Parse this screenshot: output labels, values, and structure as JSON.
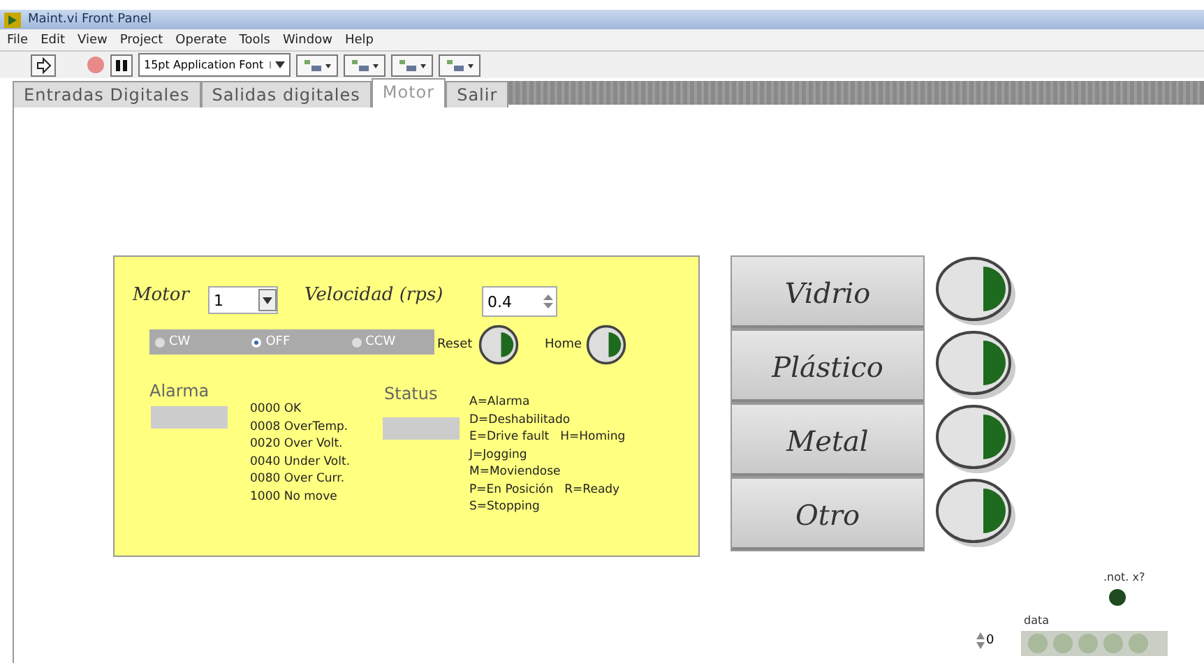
{
  "window": {
    "title": "Maint.vi Front Panel"
  },
  "menu": [
    "File",
    "Edit",
    "View",
    "Project",
    "Operate",
    "Tools",
    "Window",
    "Help"
  ],
  "toolbar": {
    "font": "15pt Application Font"
  },
  "tabs": [
    {
      "label": "Entradas Digitales",
      "selected": false
    },
    {
      "label": "Salidas digitales",
      "selected": false
    },
    {
      "label": "Motor",
      "selected": true
    },
    {
      "label": "Salir",
      "selected": false
    }
  ],
  "motor_panel": {
    "motor_label": "Motor",
    "motor_value": "1",
    "speed_label": "Velocidad (rps)",
    "speed_value": "0.4",
    "direction": [
      {
        "label": "CW",
        "selected": false
      },
      {
        "label": "OFF",
        "selected": true
      },
      {
        "label": "CCW",
        "selected": false
      }
    ],
    "reset_label": "Reset",
    "home_label": "Home",
    "alarm_label": "Alarma",
    "alarm_codes": [
      "0000 OK",
      "0008 OverTemp.",
      "0020 Over Volt.",
      "0040 Under Volt.",
      "0080 Over Curr.",
      "1000 No move"
    ],
    "status_label": "Status",
    "status_codes": [
      [
        "A=Alarma"
      ],
      [
        "D=Deshabilitado"
      ],
      [
        "E=Drive fault",
        "H=Homing"
      ],
      [
        "J=Jogging"
      ],
      [
        "M=Moviendose"
      ],
      [
        "P=En Posición",
        "R=Ready"
      ],
      [
        "S=Stopping"
      ]
    ]
  },
  "material_buttons": [
    "Vidrio",
    "Plástico",
    "Metal",
    "Otro"
  ],
  "not_x": {
    "label": ".not. x?",
    "on": false
  },
  "data": {
    "label": "data",
    "index": "0",
    "leds": [
      {
        "on": false
      },
      {
        "on": false
      },
      {
        "on": false
      },
      {
        "on": false
      },
      {
        "on": false
      }
    ]
  }
}
